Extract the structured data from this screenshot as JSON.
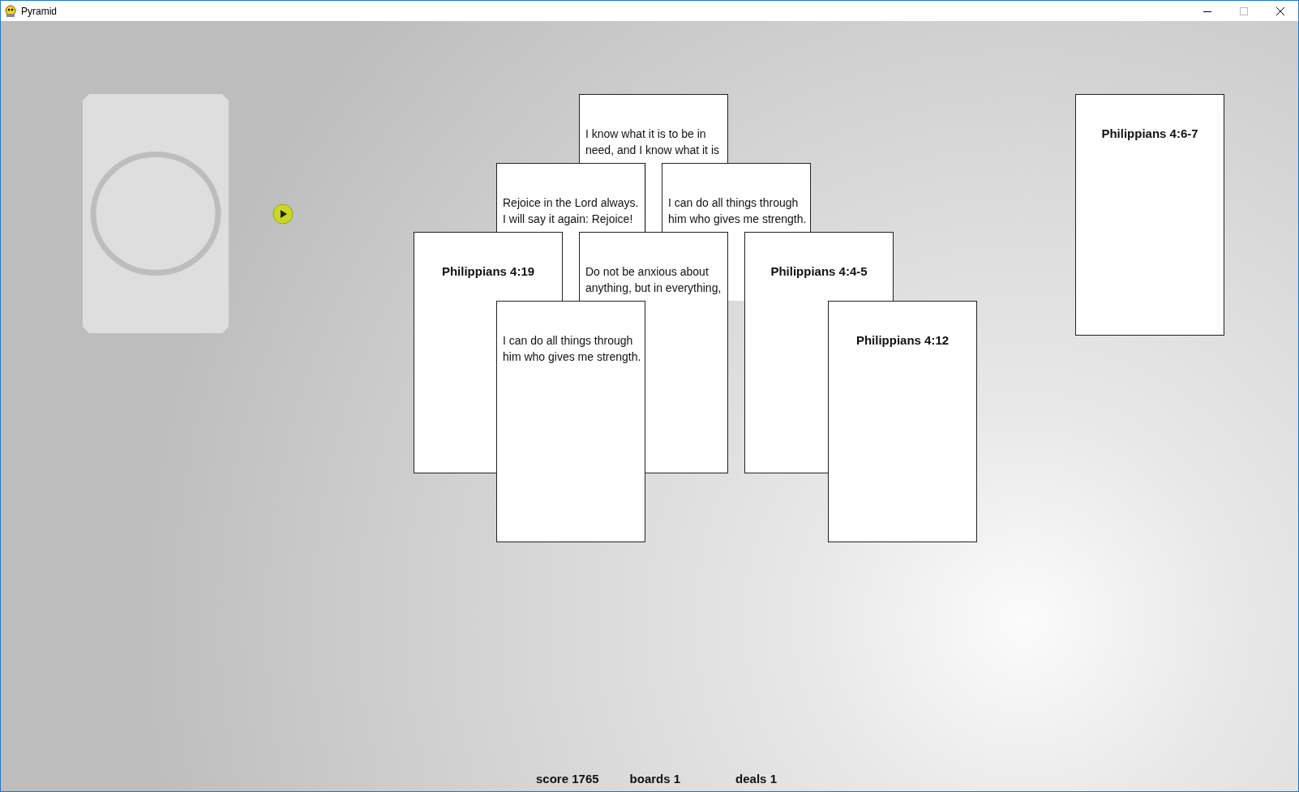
{
  "window": {
    "title": "Pyramid"
  },
  "stock": {
    "kind": "empty"
  },
  "cards": [
    {
      "kind": "verse",
      "text": "I know what it is to be in need, and I know what it is"
    },
    {
      "kind": "verse",
      "text": "Rejoice in the Lord always. I will say it again: Rejoice!"
    },
    {
      "kind": "verse",
      "text": "I can do all things through him who gives me strength."
    },
    {
      "kind": "reference",
      "text": "Philippians 4:19"
    },
    {
      "kind": "verse",
      "text": "Do not be anxious about anything, but in everything,"
    },
    {
      "kind": "reference",
      "text": "Philippians 4:4-5"
    },
    {
      "kind": "verse",
      "text": "I can do all things through him who gives me strength."
    },
    {
      "kind": "reference",
      "text": "Philippians 4:12"
    }
  ],
  "waste": {
    "kind": "reference",
    "text": "Philippians 4:6-7"
  },
  "status": [
    "score 1765",
    "boards 1",
    "deals 1"
  ]
}
